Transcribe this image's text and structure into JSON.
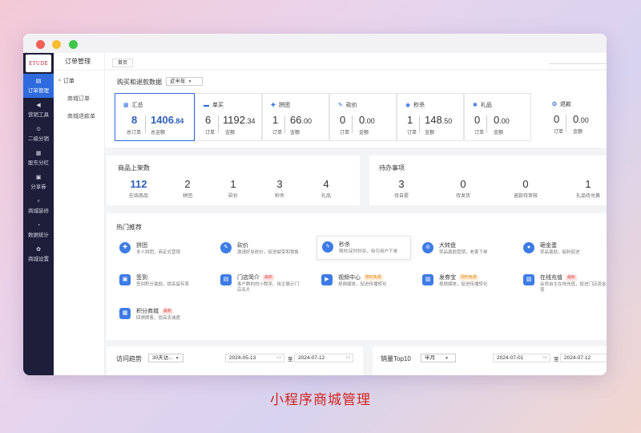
{
  "logo": {
    "text": "ETUDE"
  },
  "sidebar": {
    "items": [
      {
        "label": "订单管理",
        "icon": "document-icon"
      },
      {
        "label": "营销工具",
        "icon": "megaphone-icon"
      },
      {
        "label": "二级分销",
        "icon": "share-icon"
      },
      {
        "label": "股东分红",
        "icon": "chart-icon"
      },
      {
        "label": "分享券",
        "icon": "coupon-icon"
      },
      {
        "label": "商城装修",
        "icon": "brush-icon"
      },
      {
        "label": "数据统计",
        "icon": "pie-icon"
      },
      {
        "label": "商城设置",
        "icon": "gear-icon"
      }
    ]
  },
  "subnav": {
    "title": "订单管理",
    "group": "订单",
    "items": [
      "商城订单",
      "商城退款单"
    ]
  },
  "topbar": {
    "tab": "首页"
  },
  "purchase": {
    "title": "购买和退款数据",
    "period": "近半年",
    "cards": [
      {
        "name": "汇总",
        "count": "8",
        "amount_int": "1406",
        "amount_dec": ".84",
        "count_label": "总订单",
        "amount_label": "总金额",
        "icon": "grid-icon"
      },
      {
        "name": "单买",
        "count": "6",
        "amount_int": "1192",
        "amount_dec": ".34",
        "count_label": "订单",
        "amount_label": "金额",
        "icon": "cart-icon"
      },
      {
        "name": "拼团",
        "count": "1",
        "amount_int": "66",
        "amount_dec": ".00",
        "count_label": "订单",
        "amount_label": "金额",
        "icon": "group-icon"
      },
      {
        "name": "砍价",
        "count": "0",
        "amount_int": "0",
        "amount_dec": ".00",
        "count_label": "订单",
        "amount_label": "金额",
        "icon": "knife-icon"
      },
      {
        "name": "秒杀",
        "count": "1",
        "amount_int": "148",
        "amount_dec": ".50",
        "count_label": "订单",
        "amount_label": "金额",
        "icon": "clock-icon"
      },
      {
        "name": "礼品",
        "count": "0",
        "amount_int": "0",
        "amount_dec": ".00",
        "count_label": "订单",
        "amount_label": "金额",
        "icon": "gift-icon"
      },
      {
        "name": "退款",
        "count": "0",
        "amount_int": "0",
        "amount_dec": ".00",
        "count_label": "订单",
        "amount_label": "金额",
        "icon": "refund-icon"
      }
    ]
  },
  "listing": {
    "title": "商品上架数",
    "items": [
      {
        "value": "112",
        "label": "在线商品"
      },
      {
        "value": "2",
        "label": "拼团"
      },
      {
        "value": "1",
        "label": "砍价"
      },
      {
        "value": "3",
        "label": "秒杀"
      },
      {
        "value": "4",
        "label": "礼品"
      }
    ]
  },
  "todo": {
    "title": "待办事项",
    "items": [
      {
        "value": "3",
        "label": "待自提"
      },
      {
        "value": "0",
        "label": "待发货"
      },
      {
        "value": "0",
        "label": "退款待审核"
      },
      {
        "value": "1",
        "label": "礼品待兑换"
      }
    ]
  },
  "recommend": {
    "title": "热门推荐",
    "features": [
      {
        "name": "拼团",
        "desc": "多人拼团，商定式营销",
        "tag": "",
        "icon": "puzzle-icon"
      },
      {
        "name": "砍价",
        "desc": "邀请好友砍价，促进裂变和销售",
        "tag": "",
        "icon": "knife-icon"
      },
      {
        "name": "秒杀",
        "desc": "限时/定时秒杀，吸引用户下单",
        "tag": "",
        "icon": "lightning-icon"
      },
      {
        "name": "大转盘",
        "desc": "奖品激励营销，老客下单",
        "tag": "",
        "icon": "wheel-icon"
      },
      {
        "name": "砸金蛋",
        "desc": "奖品激励，裂利促进",
        "tag": "",
        "icon": "egg-icon"
      },
      {
        "name": "签到",
        "desc": "签到积分激励，提高留存率",
        "tag": "",
        "icon": "calendar-icon"
      },
      {
        "name": "门店简介",
        "desc": "客户群的的小程序、用主展示门店名片",
        "tag": "最新",
        "tag_type": "new",
        "icon": "store-icon"
      },
      {
        "name": "视频中心",
        "desc": "视频媒体，促进传播转化",
        "tag": "限时免费",
        "tag_type": "limit",
        "icon": "video-icon"
      },
      {
        "name": "发券宝",
        "desc": "视频媒体，促进传播转化",
        "tag": "限时免费",
        "tag_type": "limit",
        "icon": "ticket-icon"
      },
      {
        "name": "在线充值",
        "desc": "会员自主在线充值，促进门店资金回笼",
        "tag": "最新",
        "tag_type": "new",
        "icon": "recharge-icon"
      },
      {
        "name": "积分商城",
        "desc": "回馈顾客，提高忠诚度",
        "tag": "最新",
        "tag_type": "new",
        "icon": "shop-icon"
      }
    ]
  },
  "visits": {
    "title": "访问趋势",
    "range": "30天访...",
    "start": "2024-05-13",
    "to": "至",
    "end": "2024-07-12"
  },
  "sales": {
    "title": "销量Top10",
    "range": "半月",
    "start": "2024-07-01",
    "to": "至",
    "end": "2024-07-12"
  },
  "caption": "小程序商城管理",
  "colors": {
    "sidebar": "#1d1e3a",
    "accent": "#2f6bde",
    "caption": "#d2241e"
  }
}
